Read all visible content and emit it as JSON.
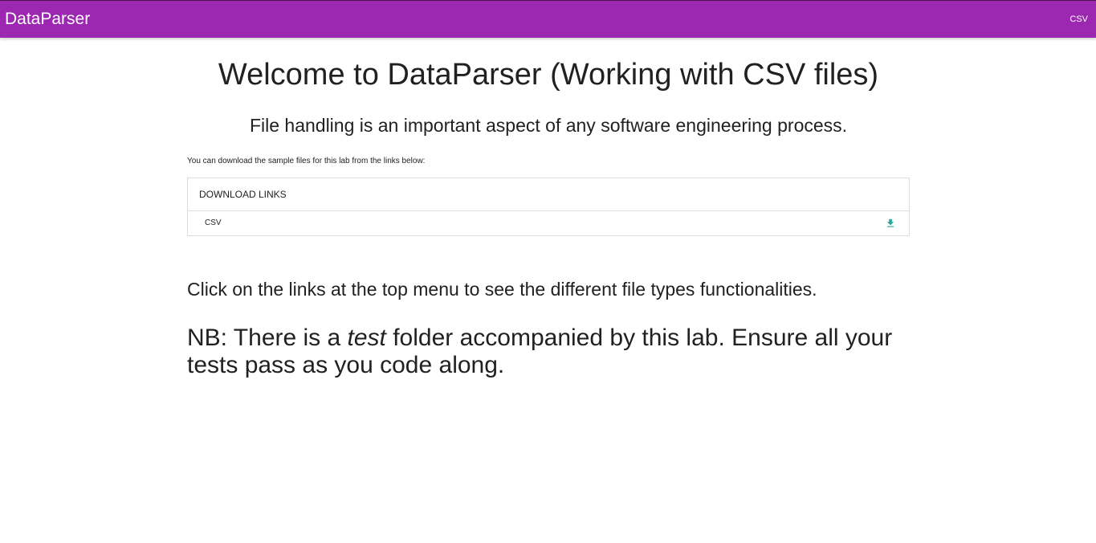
{
  "header": {
    "brand": "DataParser",
    "nav_link": "CSV",
    "background_color": "#9c27b0"
  },
  "main": {
    "title": "Welcome to DataParser (Working with CSV files)",
    "subtitle": "File handling is an important aspect of any software engineering process.",
    "intro": "You can download the sample files for this lab from the links below:",
    "downloads": {
      "header": "DOWNLOAD LINKS",
      "items": [
        {
          "label": "CSV",
          "icon": "download-icon",
          "icon_color": "#26a69a"
        }
      ]
    },
    "instruction": "Click on the links at the top menu to see the different file types functionalities.",
    "note": {
      "before": "NB: There is a ",
      "emphasis": "test",
      "after": " folder accompanied by this lab. Ensure all your tests pass as you code along."
    }
  }
}
